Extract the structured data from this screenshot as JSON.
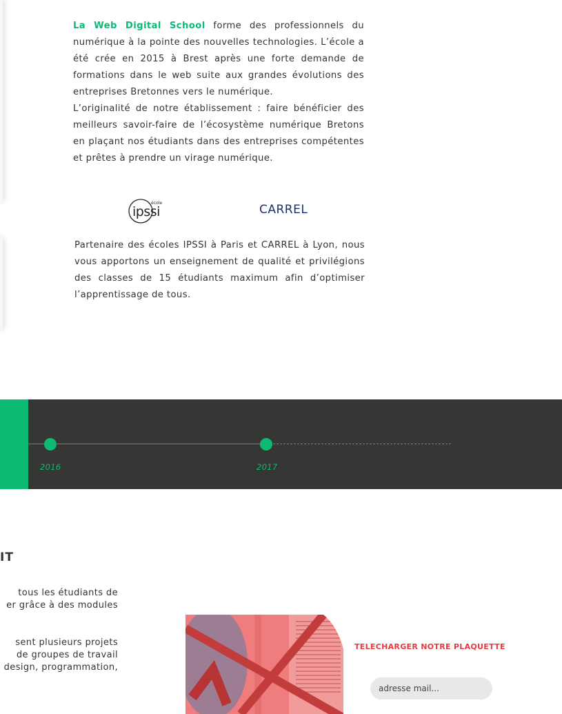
{
  "intro": {
    "brand": "La Web Digital School",
    "text1": " forme des professionnels du numérique à la pointe des nouvelles technologies. L’école a été crée en 2015 à Brest après une forte demande de formations dans le web suite aux grandes évolutions des entreprises Bretonnes vers le numérique.",
    "text2": "L’originalité de notre établissement : faire bénéficier des meilleurs savoir-faire de l’écosystème numérique Bretons en plaçant nos étudiants dans des entreprises compétentes et prêtes à prendre un virage numérique."
  },
  "partners": {
    "ipssi_logo_small": "école",
    "ipssi_logo": "ipssi",
    "carrel_logo": "CARREL",
    "text": "Partenaire des écoles IPSSI à Paris et CARREL à Lyon, nous vous apportons un enseignement de qualité et privilégions des classes de 15 étudiants maximum afin d’optimiser l’apprentissage de tous."
  },
  "timeline": {
    "years": [
      "2016",
      "2017"
    ]
  },
  "section": {
    "heading_fragment": "IT",
    "p1_lines": [
      "tous les étudiants de",
      "er grâce à des modules"
    ],
    "p2_lines": [
      "sent plusieurs projets",
      "de groupes de travail",
      "design, programmation,"
    ]
  },
  "download": {
    "label": "TELECHARGER NOTRE PLAQUETTE",
    "email_placeholder": "adresse mail..."
  },
  "colors": {
    "accent_green": "#0dba73",
    "timeline_bg": "#363634",
    "download_red": "#e63a3e",
    "carrel_blue": "#1d2f6f"
  }
}
